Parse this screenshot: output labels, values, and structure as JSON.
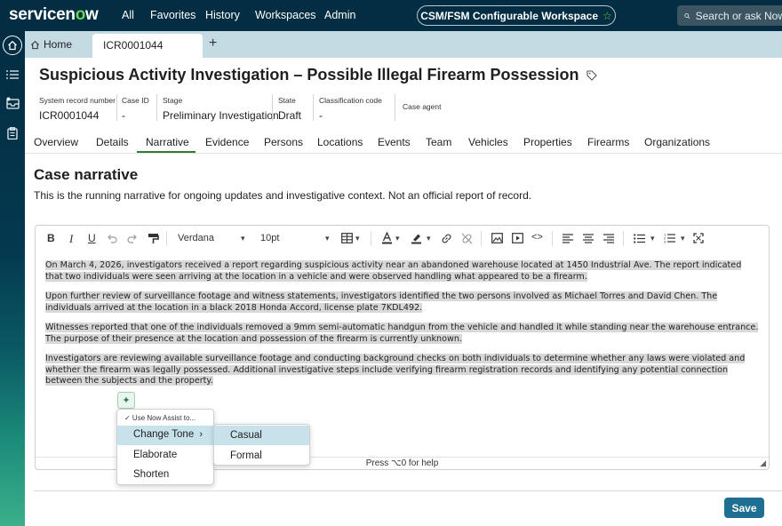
{
  "topnav": {
    "logo_prefix": "servicen",
    "logo_o": "o",
    "logo_suffix": "w",
    "links": [
      "All",
      "Favorites",
      "History",
      "Workspaces",
      "Admin"
    ],
    "workspace_label": "CSM/FSM Configurable Workspace",
    "search_placeholder": "Search or ask Now"
  },
  "rail": {
    "icons": [
      "home-icon",
      "list-icon",
      "inbox-icon",
      "clipboard-icon"
    ]
  },
  "tabs": {
    "home_label": "Home",
    "record_label": "ICR0001044",
    "add_label": "+"
  },
  "record": {
    "title": "Suspicious Activity Investigation – Possible Illegal Firearm Possession",
    "fields": [
      {
        "label": "System record number",
        "value": "ICR0001044"
      },
      {
        "label": "Case ID",
        "value": "-"
      },
      {
        "label": "Stage",
        "value": "Preliminary Investigation"
      },
      {
        "label": "State",
        "value": "Draft"
      },
      {
        "label": "Classification code",
        "value": "-"
      },
      {
        "label": "Case agent",
        "value": ""
      }
    ]
  },
  "subtabs": [
    "Overview",
    "Details",
    "Narrative",
    "Evidence",
    "Persons",
    "Locations",
    "Events",
    "Team",
    "Vehicles",
    "Properties",
    "Firearms",
    "Organizations"
  ],
  "active_subtab": "Narrative",
  "section": {
    "title": "Case narrative",
    "description": "This is the running narrative for ongoing updates and investigative context. Not an official report of record."
  },
  "editor": {
    "font_family": "Verdana",
    "font_size": "10pt",
    "paragraphs": [
      "On March 4, 2026, investigators received a report regarding suspicious activity near an abandoned warehouse located at 1450 Industrial Ave. The report indicated that two individuals were seen arriving at the location in a vehicle and were observed handling what appeared to be a firearm.",
      "Upon further review of surveillance footage and witness statements, investigators identified the two persons involved as Michael Torres and David Chen. The individuals arrived at the location in a black 2018 Honda Accord, license plate 7KDL492.",
      "Witnesses reported that one of the individuals removed a 9mm semi-automatic handgun from the vehicle and handled it while standing near the warehouse entrance. The purpose of their presence at the location and possession of the firearm is currently unknown.",
      "Investigators are reviewing available surveillance footage and conducting background checks on both individuals to determine whether any laws were violated and whether the firearm was legally possessed. Additional investigative steps include verifying firearm registration records and identifying any potential connection between the subjects and the property."
    ],
    "status_hint": "Press ⌥0 for help"
  },
  "assist_menu": {
    "header": "✓ Use Now Assist to...",
    "items": [
      "Change Tone",
      "Elaborate",
      "Shorten"
    ],
    "submenu": [
      "Casual",
      "Formal"
    ]
  },
  "footer": {
    "save_label": "Save"
  },
  "colors": {
    "nav_bg": "#032d42",
    "tab_strip": "#c5dbe3",
    "accent_green": "#62d84e",
    "save_bg": "#1e6f92",
    "highlight": "#c7e2ea"
  }
}
